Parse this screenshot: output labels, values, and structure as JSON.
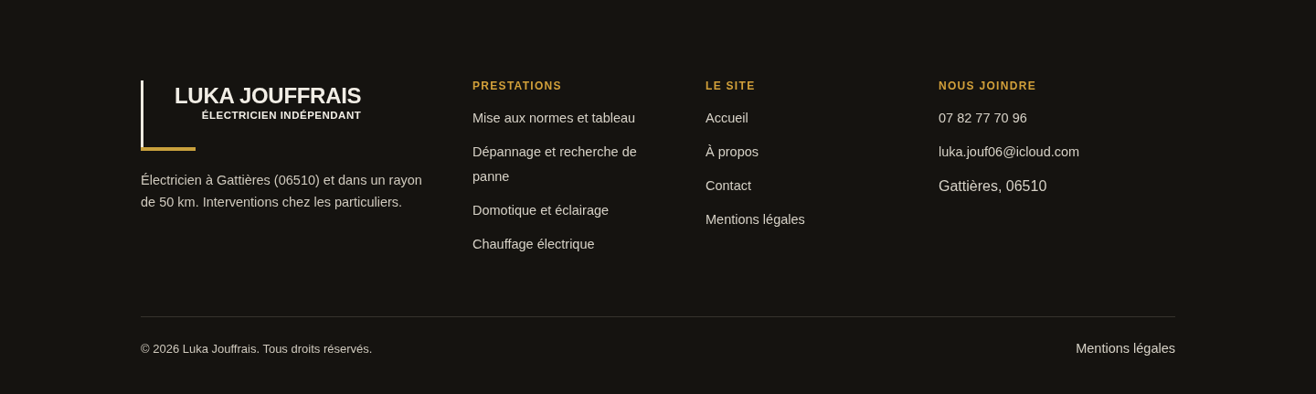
{
  "brand": {
    "name": "LUKA JOUFFRAIS",
    "tagline": "ÉLECTRICIEN INDÉPENDANT",
    "description": "Électricien à Gattières (06510) et dans un rayon de 50 km. Interventions chez les particuliers."
  },
  "columns": [
    {
      "heading": "PRESTATIONS",
      "items": [
        {
          "kind": "link",
          "text": "Mise aux normes et tableau"
        },
        {
          "kind": "link",
          "text": "Dépannage et recherche de panne"
        },
        {
          "kind": "link",
          "text": "Domotique et éclairage"
        },
        {
          "kind": "link",
          "text": "Chauffage électrique"
        }
      ]
    },
    {
      "heading": "LE SITE",
      "items": [
        {
          "kind": "link",
          "text": "Accueil"
        },
        {
          "kind": "link",
          "text": "À propos"
        },
        {
          "kind": "link",
          "text": "Contact"
        },
        {
          "kind": "link",
          "text": "Mentions légales"
        }
      ]
    },
    {
      "heading": "NOUS JOINDRE",
      "items": [
        {
          "kind": "link",
          "text": "07 82 77 70 96"
        },
        {
          "kind": "link",
          "text": "luka.jouf06@icloud.com"
        },
        {
          "kind": "address",
          "text": "Gattières, 06510"
        }
      ]
    }
  ],
  "bottom": {
    "copyright": "© 2026 Luka Jouffrais. Tous droits réservés.",
    "legal_link": "Mentions légales"
  }
}
